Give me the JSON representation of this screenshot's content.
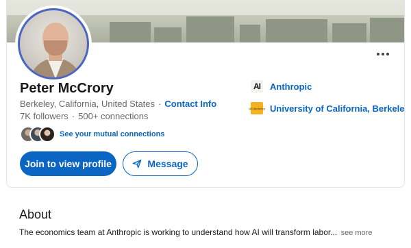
{
  "profile": {
    "name": "Peter McCrory",
    "location": "Berkeley, California, United States",
    "separator": "·",
    "contact_info_label": "Contact Info",
    "followers": "7K followers",
    "connections": "500+ connections",
    "mutual_connections_label": "See your mutual connections",
    "more_icon": "ellipsis-horizontal-icon",
    "avatar_icon": "profile-photo"
  },
  "actions": {
    "join_label": "Join to view profile",
    "message_label": "Message",
    "message_icon": "send-icon"
  },
  "experience": [
    {
      "name": "Anthropic",
      "logo": "AI",
      "logo_icon": "anthropic-logo-icon"
    },
    {
      "name": "University of California, Berkeley",
      "logo": "UC Berkeley",
      "logo_icon": "uc-berkeley-logo-icon"
    }
  ],
  "about": {
    "title": "About",
    "text": "The economics team at Anthropic is working to understand how AI will transform labor...",
    "see_more_label": "see more"
  },
  "colors": {
    "link_blue": "#0a66c2",
    "avatar_ring": "#4a66c2",
    "uc_gold": "#f5b21f"
  }
}
